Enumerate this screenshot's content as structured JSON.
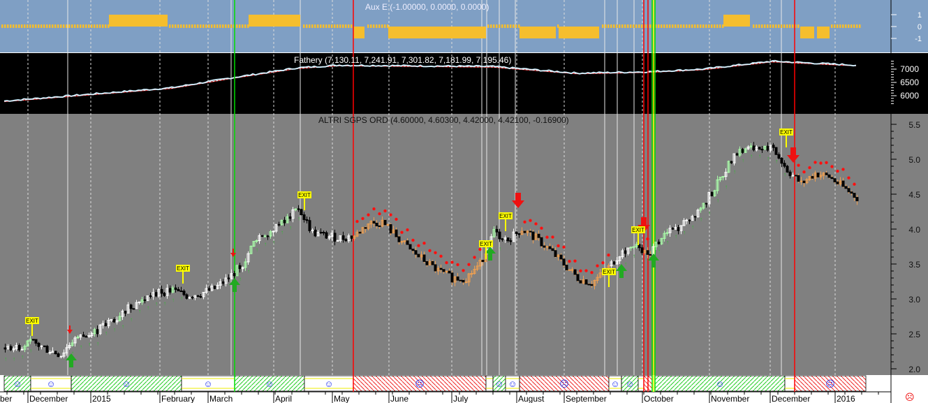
{
  "panels": {
    "aux": {
      "title": "Aux E (-1.00000, 0.0000, 0.0000)",
      "ticks": [
        "1",
        "0",
        "-1"
      ]
    },
    "index": {
      "title": "Fathery (7,130.11, 7,241.91, 7,301.82, 7,181.99, 7,195.46)",
      "ticks": [
        "7000",
        "6500",
        "6000"
      ]
    },
    "main": {
      "title": "ALTRI SGPS ORD (4.60000, 4.60300, 4.42000, 4.42100, -0.16900)",
      "ticks": [
        "5.5",
        "5.0",
        "4.5",
        "4.0",
        "3.5",
        "3.0",
        "2.5",
        "2.0"
      ]
    }
  },
  "x_axis": {
    "labels": [
      "ber",
      "December",
      "2015",
      "February",
      "March",
      "April",
      "May",
      "June",
      "July",
      "August",
      "September",
      "October",
      "November",
      "December",
      "2016"
    ]
  },
  "status_icon": "sad-face-icon",
  "colors": {
    "up": "#ffffff",
    "down": "#000000",
    "bear": "#f0a050",
    "bull_signal": "#22aa22",
    "bear_signal": "#ee1111",
    "aux": "#f5be2e",
    "exit": "#ffff00"
  },
  "chart_data": {
    "type": "candlestick",
    "title": "ALTRI SGPS ORD",
    "frequency": "weekly closes (approx.)",
    "ylim": [
      2.0,
      5.5
    ],
    "close": [
      2.3,
      2.33,
      2.37,
      2.28,
      2.2,
      2.45,
      2.48,
      2.6,
      2.75,
      2.9,
      3.0,
      3.1,
      3.12,
      3.05,
      3.08,
      3.15,
      3.3,
      3.5,
      3.88,
      3.98,
      4.1,
      4.3,
      3.95,
      3.9,
      3.87,
      3.9,
      4.08,
      4.1,
      3.9,
      3.7,
      3.55,
      3.4,
      3.3,
      3.3,
      3.5,
      3.95,
      3.85,
      4.0,
      3.87,
      3.7,
      3.5,
      3.3,
      3.23,
      3.4,
      3.65,
      3.75,
      3.62,
      3.9,
      4.0,
      4.15,
      4.35,
      4.65,
      5.0,
      5.15,
      5.15,
      5.15,
      4.85,
      4.65,
      4.8,
      4.75,
      4.6,
      4.45
    ],
    "index_series": {
      "name": "Fathery",
      "ylim": [
        5700,
        7400
      ],
      "week": [
        0,
        12,
        16,
        21,
        24,
        35,
        41,
        46,
        50,
        55,
        61
      ],
      "value": [
        5800,
        6300,
        6650,
        7050,
        7150,
        7100,
        6850,
        6900,
        7000,
        7300,
        7150
      ]
    },
    "aux_series": {
      "name": "Aux E",
      "ylim": [
        -1.5,
        1.5
      ],
      "segments": [
        {
          "from": 7.5,
          "to": 11.7,
          "value": 1
        },
        {
          "from": 17.5,
          "to": 21.2,
          "value": 1
        },
        {
          "from": 51.5,
          "to": 53.4,
          "value": 1
        },
        {
          "from": 25,
          "to": 25.8,
          "value": -1
        },
        {
          "from": 27.5,
          "to": 34.5,
          "value": -1
        },
        {
          "from": 36.9,
          "to": 39.5,
          "value": -1
        },
        {
          "from": 39.7,
          "to": 42.6,
          "value": -1
        },
        {
          "from": 57,
          "to": 58,
          "value": -1
        },
        {
          "from": 58.2,
          "to": 59.1,
          "value": -1
        }
      ]
    },
    "sentiment": [
      {
        "from": 0,
        "to": 1.9,
        "mood": "bull",
        "face": "☺"
      },
      {
        "from": 1.9,
        "to": 4.8,
        "mood": "neutral",
        "face": "☺"
      },
      {
        "from": 4.8,
        "to": 12.7,
        "mood": "bull",
        "face": "☺"
      },
      {
        "from": 12.7,
        "to": 16.5,
        "mood": "neutral",
        "face": "☺"
      },
      {
        "from": 16.5,
        "to": 21.5,
        "mood": "bull",
        "face": "☺"
      },
      {
        "from": 21.5,
        "to": 25,
        "mood": "neutral",
        "face": "☺"
      },
      {
        "from": 25,
        "to": 34.5,
        "mood": "bear",
        "face": "☹"
      },
      {
        "from": 34.5,
        "to": 35,
        "mood": "neutral",
        "face": ""
      },
      {
        "from": 35,
        "to": 35.9,
        "mood": "bull",
        "face": "☺"
      },
      {
        "from": 35.9,
        "to": 36.9,
        "mood": "neutral",
        "face": "☺"
      },
      {
        "from": 36.9,
        "to": 43.3,
        "mood": "bear",
        "face": "☹"
      },
      {
        "from": 43.3,
        "to": 44.2,
        "mood": "neutral",
        "face": "☺"
      },
      {
        "from": 44.2,
        "to": 45.4,
        "mood": "bull",
        "face": "☺"
      },
      {
        "from": 45.4,
        "to": 45.8,
        "mood": "neutral",
        "face": ""
      },
      {
        "from": 45.8,
        "to": 46.4,
        "mood": "bear",
        "face": ""
      },
      {
        "from": 46.6,
        "to": 55.9,
        "mood": "bull",
        "face": "☺"
      },
      {
        "from": 55.9,
        "to": 56.6,
        "mood": "neutral",
        "face": ""
      },
      {
        "from": 56.6,
        "to": 61.7,
        "mood": "bear",
        "face": "☹"
      }
    ],
    "signals": [
      {
        "week": 4.8,
        "type": "buy",
        "price": 2.22
      },
      {
        "week": 4.7,
        "type": "sell-small",
        "price": 2.5
      },
      {
        "week": 16.4,
        "type": "sell-small",
        "price": 3.6
      },
      {
        "week": 16.5,
        "type": "buy",
        "price": 3.3
      },
      {
        "week": 34.8,
        "type": "buy",
        "price": 3.75
      },
      {
        "week": 36.8,
        "type": "sell",
        "price": 4.3
      },
      {
        "week": 44.2,
        "type": "buy",
        "price": 3.5
      },
      {
        "week": 45.8,
        "type": "sell",
        "price": 3.95
      },
      {
        "week": 46.5,
        "type": "buy",
        "price": 3.65
      },
      {
        "week": 56.5,
        "type": "sell",
        "price": 4.95
      }
    ],
    "exits": [
      {
        "week": 2.0,
        "price": 2.65,
        "label": "EXIT"
      },
      {
        "week": 12.8,
        "price": 3.4,
        "label": "EXIT"
      },
      {
        "week": 21.5,
        "price": 4.45,
        "label": "EXIT"
      },
      {
        "week": 34.5,
        "price": 3.75,
        "label": "EXIT"
      },
      {
        "week": 35.9,
        "price": 4.15,
        "label": "EXIT"
      },
      {
        "week": 43.3,
        "price": 3.35,
        "label": "EXIT"
      },
      {
        "week": 45.4,
        "price": 3.95,
        "label": "EXIT"
      },
      {
        "week": 56.0,
        "price": 5.35,
        "label": "EXIT"
      }
    ],
    "signal_lines": [
      {
        "week": 16.5,
        "color": "#00dd00"
      },
      {
        "week": 25,
        "color": "#ff0000"
      },
      {
        "week": 45.8,
        "color": "#ff0000"
      },
      {
        "week": 46.1,
        "color": "#ff0000"
      },
      {
        "week": 46.4,
        "color": "#00dd00"
      },
      {
        "week": 46.5,
        "color": "#ffff00"
      },
      {
        "week": 46.6,
        "color": "#00dd00"
      },
      {
        "week": 56.6,
        "color": "#ff0000"
      }
    ]
  }
}
